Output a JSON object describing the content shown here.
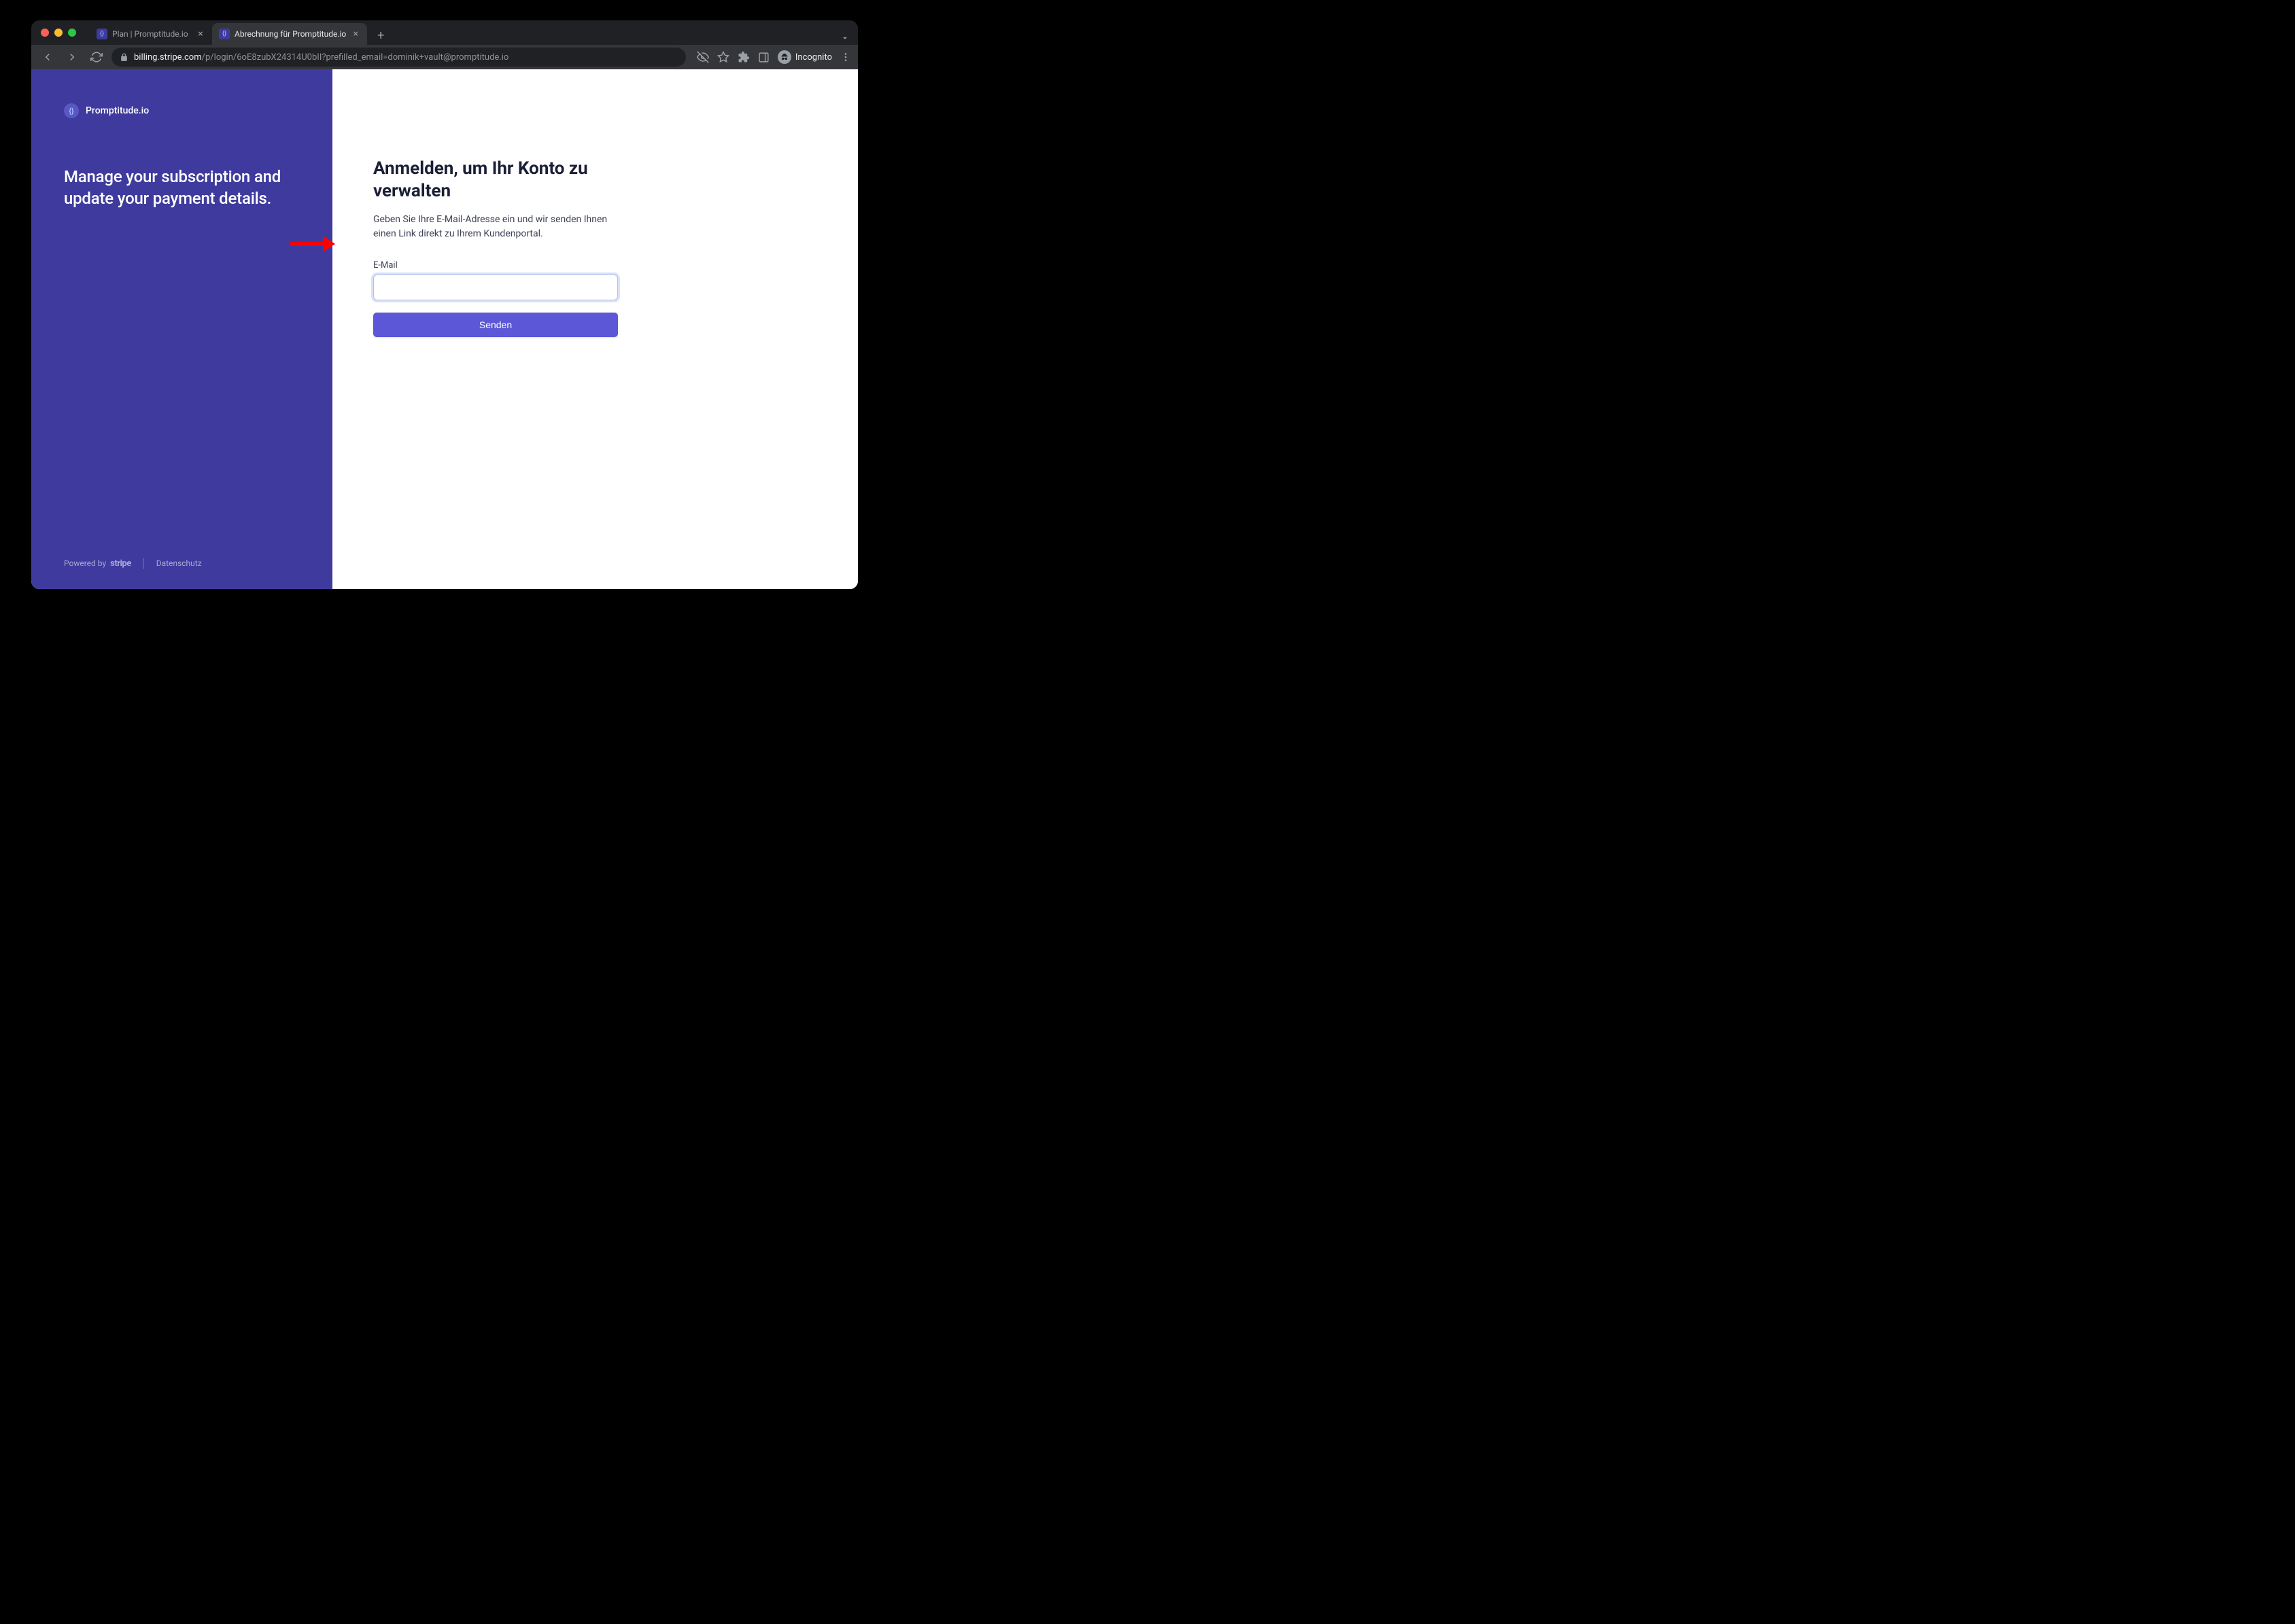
{
  "browser": {
    "tabs": [
      {
        "title": "Plan | Promptitude.io",
        "active": false
      },
      {
        "title": "Abrechnung für Promptitude.io",
        "active": true
      }
    ],
    "url": {
      "domain": "billing.stripe.com",
      "path": "/p/login/6oE8zubX24314U0bII?prefilled_email=dominik+vault@promptitude.io"
    },
    "incognito_label": "Incognito"
  },
  "left_panel": {
    "brand_name": "Promptitude.io",
    "heading": "Manage your subscription and update your payment details.",
    "powered_by_label": "Powered by",
    "stripe_label": "stripe",
    "privacy_link": "Datenschutz"
  },
  "form": {
    "heading": "Anmelden, um Ihr Konto zu verwalten",
    "subtitle": "Geben Sie Ihre E-Mail-Adresse ein und wir senden Ihnen einen Link direkt zu Ihrem Kundenportal.",
    "email_label": "E-Mail",
    "email_value": "",
    "submit_label": "Senden"
  }
}
